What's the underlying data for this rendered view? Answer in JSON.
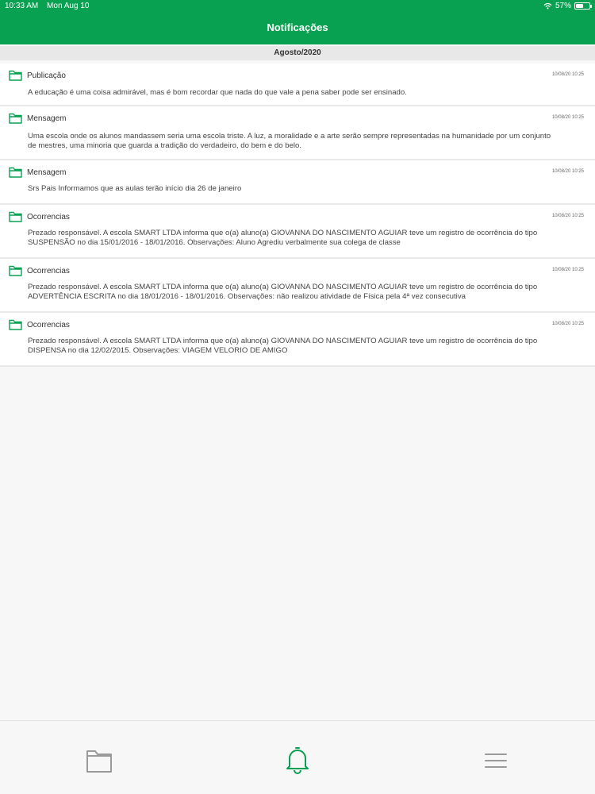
{
  "status_bar": {
    "time": "10:33 AM",
    "date": "Mon Aug 10",
    "battery": "57%",
    "battery_level": 0.57
  },
  "header": {
    "title": "Notificações"
  },
  "section": {
    "month": "Agosto/2020"
  },
  "notifications": [
    {
      "type": "Publicação",
      "date": "10/08/20 10:25",
      "lines": [
        "A educação é uma coisa admirável, mas é bom recordar que nada do que vale a pena saber pode ser ensinado."
      ]
    },
    {
      "type": "Mensagem",
      "date": "10/08/20 10:25",
      "lines": [
        "Uma escola onde os alunos mandassem seria uma escola triste. A luz, a moralidade e a arte serão sempre representadas na humanidade por um conjunto",
        "de mestres, uma minoria que guarda a tradição do verdadeiro, do bem e do belo."
      ]
    },
    {
      "type": "Mensagem",
      "date": "10/08/20 10:25",
      "lines": [
        "Srs Pais Informamos que as aulas terão início dia 26 de janeiro"
      ]
    },
    {
      "type": "Ocorrencias",
      "date": "10/08/20 10:25",
      "lines": [
        "Prezado responsável. A escola SMART LTDA informa que o(a) aluno(a) GIOVANNA DO NASCIMENTO AGUIAR teve um registro de ocorrência do tipo",
        "SUSPENSÃO no dia 15/01/2016 - 18/01/2016. Observações: Aluno Agrediu verbalmente sua colega de classe"
      ]
    },
    {
      "type": "Ocorrencias",
      "date": "10/08/20 10:25",
      "lines": [
        "Prezado responsável. A escola SMART LTDA informa que o(a) aluno(a) GIOVANNA DO NASCIMENTO AGUIAR teve um registro de ocorrência do tipo",
        "ADVERTÊNCIA ESCRITA no dia 18/01/2016 - 18/01/2016. Observações: não realizou atividade de Física pela 4ª vez consecutiva"
      ]
    },
    {
      "type": "Ocorrencias",
      "date": "10/08/20 10:25",
      "lines": [
        "Prezado responsável. A escola SMART LTDA informa que o(a) aluno(a) GIOVANNA DO NASCIMENTO AGUIAR teve um registro de ocorrência do tipo",
        "DISPENSA no dia 12/02/2015. Observações: VIAGEM VELORIO DE AMIGO"
      ]
    }
  ],
  "tabbar": {
    "tabs": [
      {
        "icon": "folder-icon",
        "active": false
      },
      {
        "icon": "bell-icon",
        "active": true
      },
      {
        "icon": "menu-icon",
        "active": false
      }
    ]
  },
  "colors": {
    "brand": "#08a151",
    "icon_inactive": "#9a9a9a"
  }
}
